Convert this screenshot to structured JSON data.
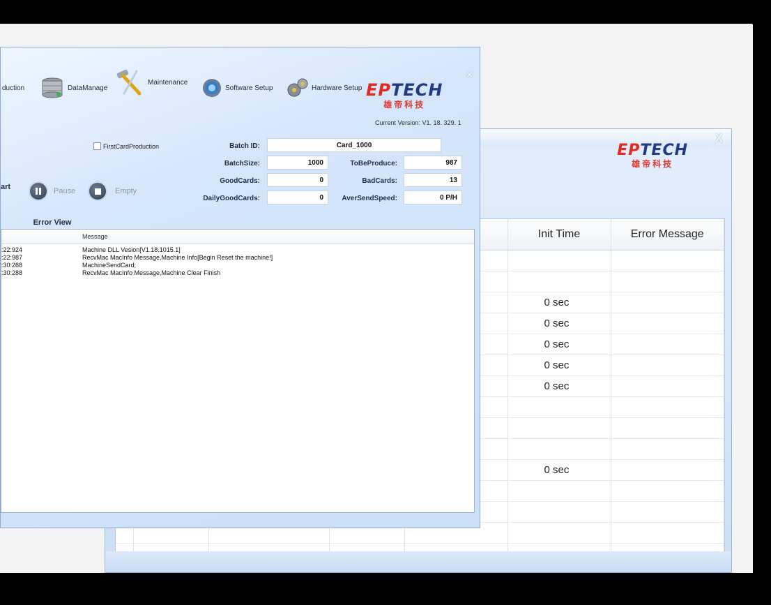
{
  "front": {
    "toolbar": {
      "production_label": "duction",
      "datamanage_label": "DataManage",
      "maintenance_label": "Maintenance",
      "software_setup_label": "Software Setup",
      "hardware_setup_label": "Hardware Setup"
    },
    "logo": {
      "en_prefix": "EP",
      "en_rest": "TECH",
      "cn": "雄帝科技"
    },
    "version": "Current Version:  V1. 18. 329. 1",
    "first_card_label": "FirstCardProduction",
    "fields": {
      "batch_id_label": "Batch ID:",
      "batch_id_value": "Card_1000",
      "batch_size_label": "BatchSize:",
      "batch_size_value": "1000",
      "to_be_produce_label": "ToBeProduce:",
      "to_be_produce_value": "987",
      "good_cards_label": "GoodCards:",
      "good_cards_value": "0",
      "bad_cards_label": "BadCards:",
      "bad_cards_value": "13",
      "daily_good_label": "DailyGoodCards:",
      "daily_good_value": "0",
      "aver_speed_label": "AverSendSpeed:",
      "aver_speed_value": "0 P/H"
    },
    "controls": {
      "start": "art",
      "pause": "Pause",
      "empty": "Empty"
    },
    "tab_error": "Error View",
    "log": {
      "header_message": "Message",
      "rows": [
        {
          "time": ":22:924",
          "message": "Machine DLL Vesion[V1.18.1015.1]"
        },
        {
          "time": ":22:987",
          "message": "RecvMac MacInfo Message,Machine Info[Begin Reset the machine!]"
        },
        {
          "time": ":30:288",
          "message": "MachineSendCard;"
        },
        {
          "time": ":30:288",
          "message": "RecvMac MacInfo Message,Machine Clear Finish"
        }
      ]
    }
  },
  "back": {
    "close": "X",
    "logo": {
      "en_prefix": "EP",
      "en_rest": "TECH",
      "cn": "雄帝科技"
    },
    "table": {
      "headers": [
        "Init Time",
        "Error Message"
      ],
      "rows": [
        "",
        "",
        "0 sec",
        "0 sec",
        "0 sec",
        "0 sec",
        "0 sec",
        "",
        "",
        "",
        "0 sec",
        "",
        "",
        "",
        ""
      ],
      "marker": "!"
    }
  },
  "colors": {
    "accent": "#233a85",
    "logo_red": "#e02a22"
  }
}
